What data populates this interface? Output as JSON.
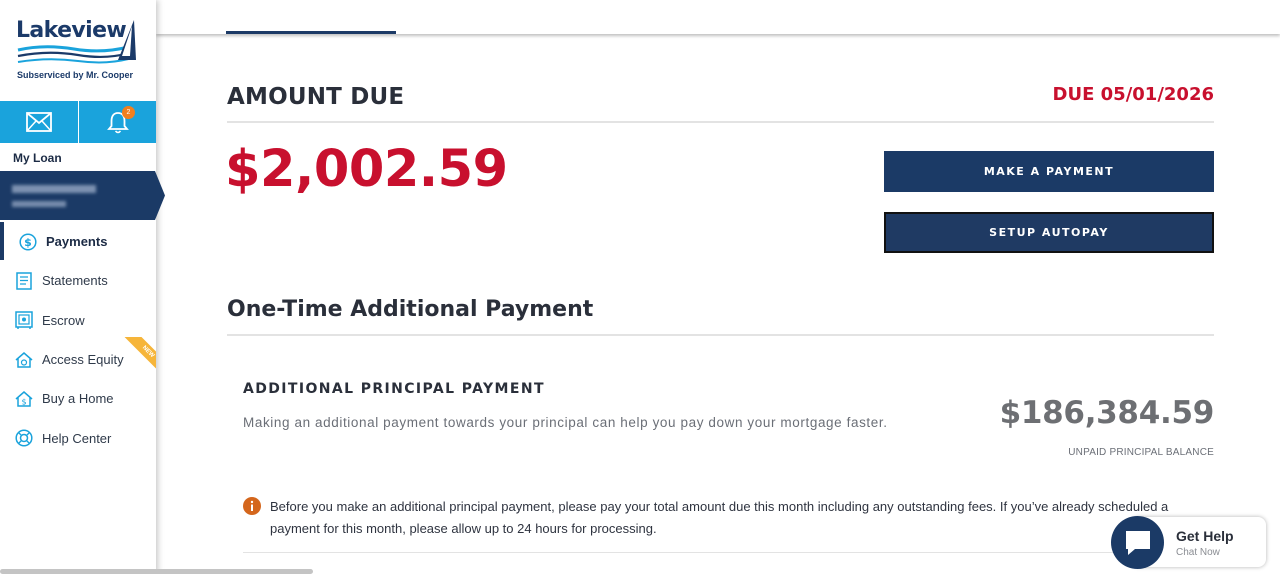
{
  "brand": {
    "name": "Lakeview",
    "subtitle": "Subserviced by Mr. Cooper",
    "color_primary": "#1b3a66",
    "color_accent": "#1aa3dc",
    "color_alert": "#c8102e"
  },
  "toolbar": {
    "mail_icon": "mail-icon",
    "bell_icon": "bell-icon",
    "notification_count": "2"
  },
  "sidebar": {
    "section_label": "My Loan",
    "nav": [
      {
        "label": "Payments",
        "icon": "dollar-circle-icon",
        "active": true
      },
      {
        "label": "Statements",
        "icon": "document-icon",
        "active": false
      },
      {
        "label": "Escrow",
        "icon": "safe-icon",
        "active": false
      },
      {
        "label": "Access Equity",
        "icon": "home-refresh-icon",
        "active": false
      },
      {
        "label": "Buy a Home",
        "icon": "home-dollar-icon",
        "active": false
      },
      {
        "label": "Help Center",
        "icon": "lifebuoy-icon",
        "active": false
      }
    ],
    "new_badge": "NEW"
  },
  "amount_due": {
    "title": "AMOUNT DUE",
    "due_date": "DUE 05/01/2026",
    "amount": "$2,002.59",
    "make_payment_label": "MAKE A PAYMENT",
    "setup_autopay_label": "SETUP AUTOPAY"
  },
  "one_time": {
    "title": "One-Time Additional Payment",
    "section_title": "ADDITIONAL PRINCIPAL PAYMENT",
    "description": "Making an additional payment towards your principal can help you pay down your mortgage faster.",
    "balance": "$186,384.59",
    "balance_label": "UNPAID PRINCIPAL BALANCE",
    "notice": "Before you make an additional principal payment, please pay your total amount due this month including any outstanding fees. If you’ve already scheduled a payment for this month, please allow up to 24 hours for processing."
  },
  "help": {
    "title": "Get Help",
    "subtitle": "Chat Now"
  }
}
